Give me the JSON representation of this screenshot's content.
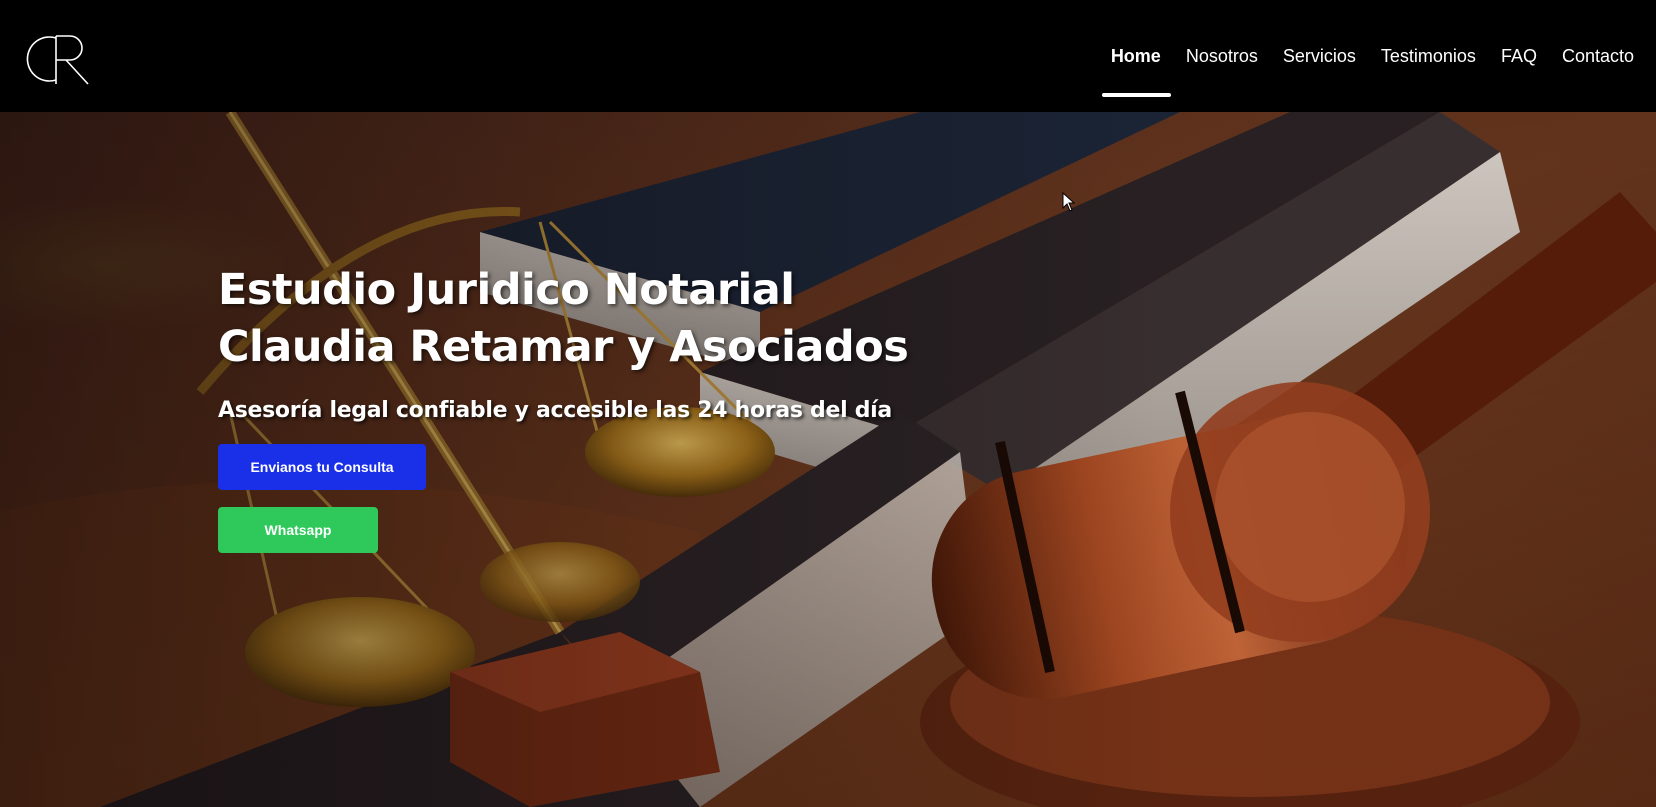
{
  "header": {
    "logo_text": "CR",
    "nav": [
      {
        "label": "Home",
        "active": true
      },
      {
        "label": "Nosotros",
        "active": false
      },
      {
        "label": "Servicios",
        "active": false
      },
      {
        "label": "Testimonios",
        "active": false
      },
      {
        "label": "FAQ",
        "active": false
      },
      {
        "label": "Contacto",
        "active": false
      }
    ]
  },
  "hero": {
    "title_line1": "Estudio Juridico Notarial",
    "title_line2": "Claudia Retamar y Asociados",
    "subtitle": "Asesoría legal confiable y accesible las 24 horas del día",
    "consulta_button": "Envianos tu Consulta",
    "whatsapp_button": "Whatsapp"
  },
  "colors": {
    "header_bg": "#000000",
    "consulta_button": "#1a2fe8",
    "whatsapp_button": "#2ec95a",
    "text": "#ffffff"
  },
  "icons": [
    "cr-logo",
    "mouse-cursor-icon"
  ]
}
